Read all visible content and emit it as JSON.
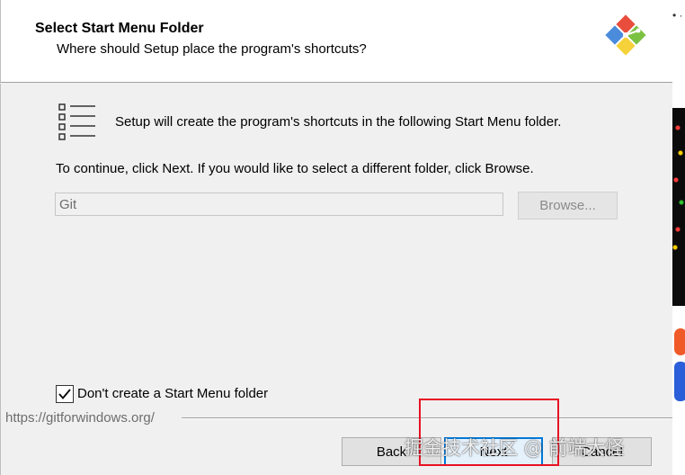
{
  "header": {
    "title": "Select Start Menu Folder",
    "subtitle": "Where should Setup place the program's shortcuts?"
  },
  "main": {
    "info_text": "Setup will create the program's shortcuts in the following Start Menu folder.",
    "continue_text": "To continue, click Next. If you would like to select a different folder, click Browse.",
    "folder_input_value": "Git",
    "browse_label": "Browse...",
    "no_folder_checkbox": {
      "label": "Don't create a Start Menu folder",
      "checked": true
    }
  },
  "footer": {
    "url": "https://gitforwindows.org/",
    "back_label": "Back",
    "next_label": "Next",
    "cancel_label": "Cancel"
  },
  "watermark": "掘金技术社区 @ 前端大怪",
  "colors": {
    "accent": "#0078d7",
    "highlight": "#e81123",
    "logo_red": "#e94e3c",
    "logo_blue": "#4a8bdc",
    "logo_green": "#7cc242",
    "logo_yellow": "#f5d23a"
  }
}
